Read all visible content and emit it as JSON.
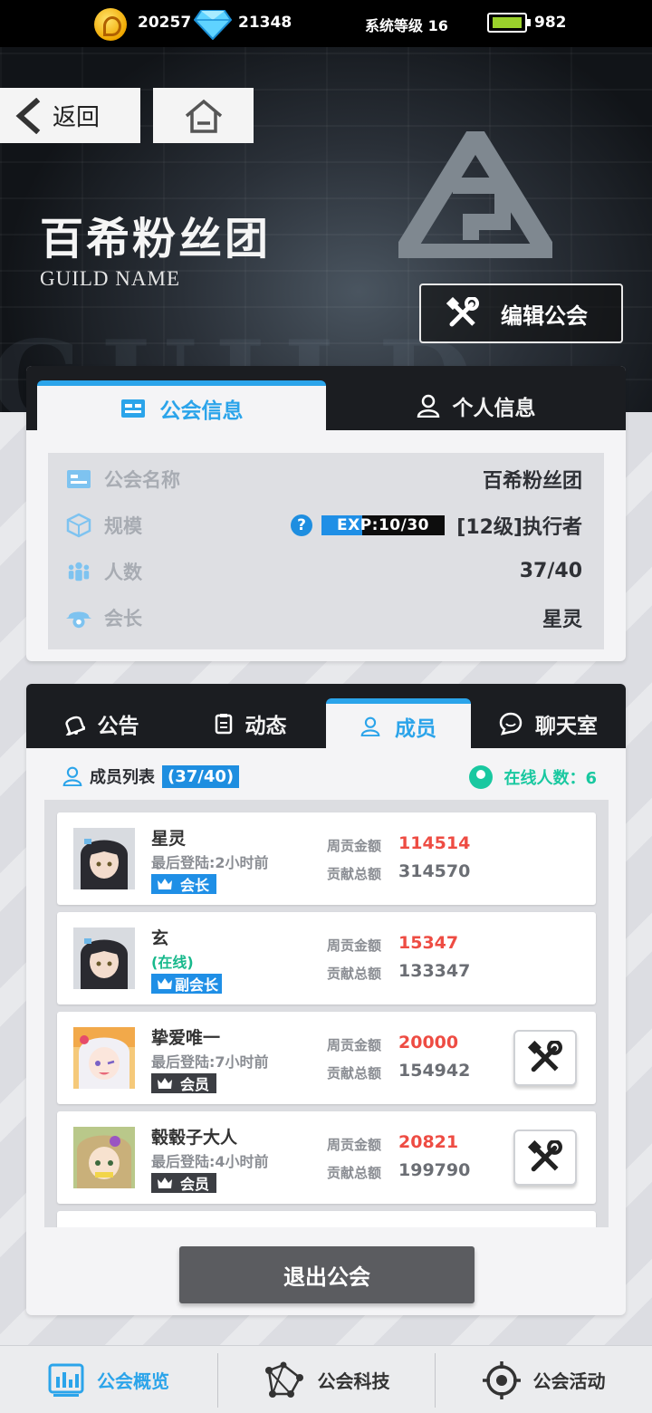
{
  "status_bar": {
    "coins": "20257",
    "gems": "21348",
    "system_level": "系统等级 16",
    "energy": "982",
    "coin_icon": "gold-coin-icon",
    "gem_icon": "diamond-icon",
    "energy_icon": "battery-icon"
  },
  "header": {
    "back_label": "返回",
    "guild_name": "百希粉丝团",
    "guild_name_en": "GUILD NAME",
    "edit_label": "编辑公会"
  },
  "info_panel": {
    "tabs": [
      {
        "label": "公会信息",
        "icon": "id-card-icon",
        "active": true
      },
      {
        "label": "个人信息",
        "icon": "person-icon",
        "active": false
      }
    ],
    "rows": {
      "name": {
        "label": "公会名称",
        "value": "百希粉丝团"
      },
      "scale": {
        "label": "规模",
        "exp_label": "EXP:10/30",
        "exp_progress": 0.333,
        "value": "[12级]执行者"
      },
      "members": {
        "label": "人数",
        "value": "37/40"
      },
      "leader": {
        "label": "会长",
        "value": "星灵"
      }
    }
  },
  "member_panel": {
    "tabs": [
      {
        "label": "公告",
        "icon": "bell-icon"
      },
      {
        "label": "动态",
        "icon": "clipboard-icon"
      },
      {
        "label": "成员",
        "icon": "person-icon",
        "active": true
      },
      {
        "label": "聊天室",
        "icon": "chat-icon"
      }
    ],
    "list_title": "成员列表",
    "list_count": "(37/40)",
    "online_label": "在线人数：6",
    "weekly_label": "周贡金额",
    "total_label": "贡献总额",
    "members": [
      {
        "name": "星灵",
        "status": "最后登陆:2小时前",
        "role": "会长",
        "weekly": "114514",
        "total": "314570"
      },
      {
        "name": "玄",
        "status": "(在线)",
        "role": "副会长",
        "weekly": "15347",
        "total": "133347"
      },
      {
        "name": "挚爱唯一",
        "status": "最后登陆:7小时前",
        "role": "会员",
        "weekly": "20000",
        "total": "154942"
      },
      {
        "name": "毂毂子大人",
        "status": "最后登陆:4小时前",
        "role": "会员",
        "weekly": "20821",
        "total": "199790"
      }
    ],
    "quit_label": "退出公会"
  },
  "bottom_nav": [
    {
      "label": "公会概览",
      "icon": "bar-chart-icon",
      "active": true
    },
    {
      "label": "公会科技",
      "icon": "network-icon",
      "active": false
    },
    {
      "label": "公会活动",
      "icon": "target-icon",
      "active": false
    }
  ],
  "colors": {
    "accent": "#2ba4ea",
    "online": "#19c8a0",
    "weekly": "#ee4c43"
  }
}
